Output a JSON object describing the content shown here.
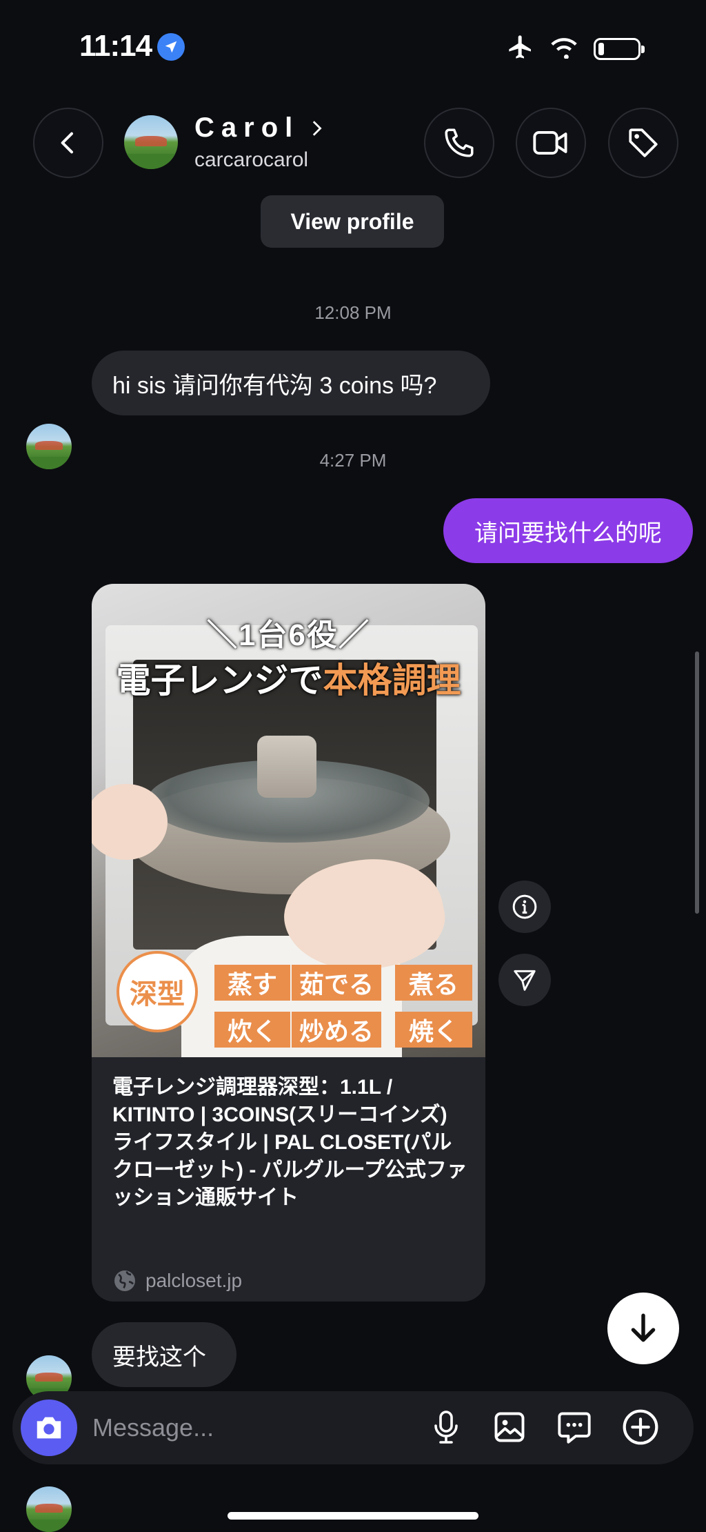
{
  "status_bar": {
    "time": "11:14"
  },
  "header": {
    "name": "Carol",
    "handle": "carcarocarol",
    "view_profile_label": "View profile"
  },
  "messages": [
    {
      "timestamp": "12:08 PM"
    },
    {
      "direction": "incoming",
      "text": "hi sis 请问你有代沟 3 coins 吗?"
    },
    {
      "timestamp": "4:27 PM"
    },
    {
      "direction": "outgoing",
      "text": "请问要找什么的呢"
    },
    {
      "direction": "incoming",
      "type": "link-card",
      "image_text": {
        "top": "＼1台6役／",
        "title_main": "電子レンジで",
        "title_accent": "本格調理",
        "seal": "深型",
        "tags": [
          "蒸す",
          "茹でる",
          "煮る",
          "炊く",
          "炒める",
          "焼く"
        ]
      },
      "title": "電子レンジ調理器深型：1.1L / KITINTO | 3COINS(スリーコインズ) ライフスタイル | PAL CLOSET(パルクローゼット) - パルグループ公式ファッション通販サイト",
      "domain": "palcloset.jp"
    },
    {
      "direction": "incoming",
      "text": "要找这个"
    }
  ],
  "composer": {
    "placeholder": "Message..."
  },
  "colors": {
    "background": "#0c0d11",
    "outgoing_bubble": "#8c3be8",
    "incoming_bubble": "#26272d",
    "camera_button": "#5b5cf2",
    "accent_orange": "#ea8e4c"
  },
  "icons": {
    "status": [
      "location-arrow-icon",
      "airplane-icon",
      "wifi-icon",
      "battery-icon"
    ],
    "header": [
      "back-chevron-icon",
      "phone-icon",
      "video-camera-icon",
      "tag-icon"
    ],
    "card_side": [
      "info-icon",
      "share-send-icon"
    ],
    "composer": [
      "camera-icon",
      "microphone-icon",
      "gallery-icon",
      "sticker-chat-icon",
      "plus-icon"
    ],
    "fab": "arrow-down-icon"
  }
}
